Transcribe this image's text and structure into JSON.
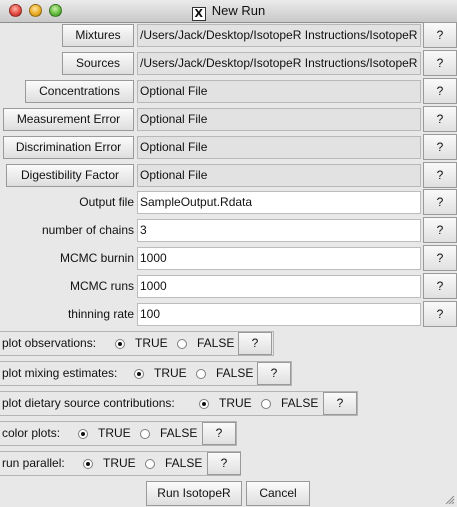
{
  "window": {
    "title": "New Run",
    "title_icon": "x11-icon"
  },
  "files": [
    {
      "label": "Mixtures",
      "value": "/Users/Jack/Desktop/IsotopeR Instructions/IsotopeR",
      "help": "?"
    },
    {
      "label": "Sources",
      "value": "/Users/Jack/Desktop/IsotopeR Instructions/IsotopeR",
      "help": "?"
    },
    {
      "label": "Concentrations",
      "value": "Optional File",
      "help": "?"
    },
    {
      "label": "Measurement Error",
      "value": "Optional File",
      "help": "?"
    },
    {
      "label": "Discrimination Error",
      "value": "Optional File",
      "help": "?"
    },
    {
      "label": "Digestibility Factor",
      "value": "Optional File",
      "help": "?"
    }
  ],
  "params": [
    {
      "label": "Output file",
      "value": "SampleOutput.Rdata",
      "help": "?"
    },
    {
      "label": "number of chains",
      "value": "3",
      "help": "?"
    },
    {
      "label": "MCMC burnin",
      "value": "1000",
      "help": "?"
    },
    {
      "label": "MCMC runs",
      "value": "1000",
      "help": "?"
    },
    {
      "label": "thinning rate",
      "value": "100",
      "help": "?"
    }
  ],
  "options": [
    {
      "label": "plot observations:",
      "true_label": "TRUE",
      "false_label": "FALSE",
      "selected": "TRUE",
      "help": "?"
    },
    {
      "label": "plot mixing estimates:",
      "true_label": "TRUE",
      "false_label": "FALSE",
      "selected": "TRUE",
      "help": "?"
    },
    {
      "label": "plot dietary source contributions:",
      "true_label": "TRUE",
      "false_label": "FALSE",
      "selected": "TRUE",
      "help": "?"
    },
    {
      "label": "color plots:",
      "true_label": "TRUE",
      "false_label": "FALSE",
      "selected": "TRUE",
      "help": "?"
    },
    {
      "label": "run parallel:",
      "true_label": "TRUE",
      "false_label": "FALSE",
      "selected": "TRUE",
      "help": "?"
    }
  ],
  "actions": {
    "run_label": "Run IsotopeR",
    "cancel_label": "Cancel"
  }
}
